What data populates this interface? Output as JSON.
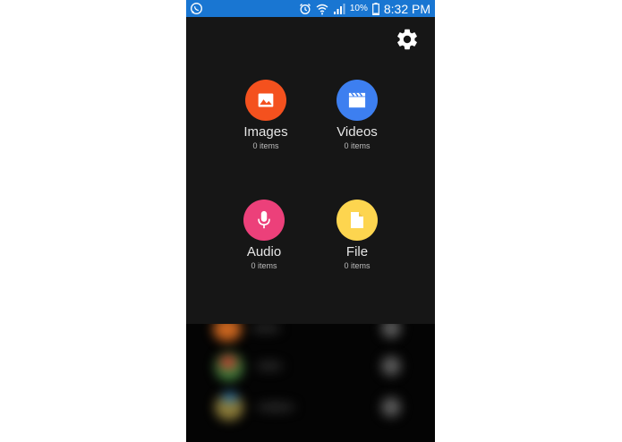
{
  "status_bar": {
    "battery_percent": "10%",
    "time": "8:32 PM",
    "background": "#1976d2"
  },
  "tiles": [
    {
      "label": "Images",
      "count": "0 items",
      "color": "#f4511e",
      "icon": "image-icon"
    },
    {
      "label": "Videos",
      "count": "0 items",
      "color": "#3d7ff0",
      "icon": "video-clapper-icon"
    },
    {
      "label": "Audio",
      "count": "0 items",
      "color": "#ec407a",
      "icon": "microphone-icon"
    },
    {
      "label": "File",
      "count": "0 items",
      "color": "#fdd54f",
      "icon": "file-icon"
    }
  ]
}
